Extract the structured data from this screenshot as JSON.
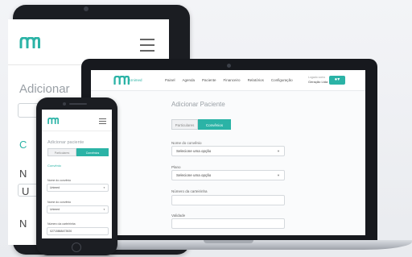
{
  "brand": {
    "name": "Unimed",
    "color": "#2bb3a6"
  },
  "tablet": {
    "title": "Adicionar",
    "fragments": [
      "C",
      "N",
      "U",
      "N"
    ]
  },
  "laptop": {
    "nav": [
      "Painel",
      "Agenda",
      "Paciente",
      "Financeiro",
      "Relatórios",
      "Configuração"
    ],
    "user_top": "Logado como",
    "user_name": "Geração Ltda",
    "user_icon": "person-icon",
    "page_title": "Adicionar Paciente",
    "tabs": [
      "Particulares",
      "Convênios"
    ],
    "fields": [
      {
        "label": "Nome do convênio",
        "value": "Selecione uma opção",
        "type": "select"
      },
      {
        "label": "Plano",
        "value": "Selecione uma opção",
        "type": "select"
      },
      {
        "label": "Número da carteirinha",
        "value": "",
        "type": "input"
      },
      {
        "label": "Validade",
        "value": "",
        "type": "input"
      }
    ]
  },
  "phone": {
    "page_title": "Adicionar paciente",
    "tabs": [
      "Particulares",
      "Convênios"
    ],
    "section": "Convênio",
    "fields": [
      {
        "label": "Nome do convênio",
        "value": "Unimed"
      },
      {
        "label": "Nome do convênio",
        "value": "Unimed"
      },
      {
        "label": "Número da carteirinha",
        "value": "02715868473920"
      }
    ]
  }
}
